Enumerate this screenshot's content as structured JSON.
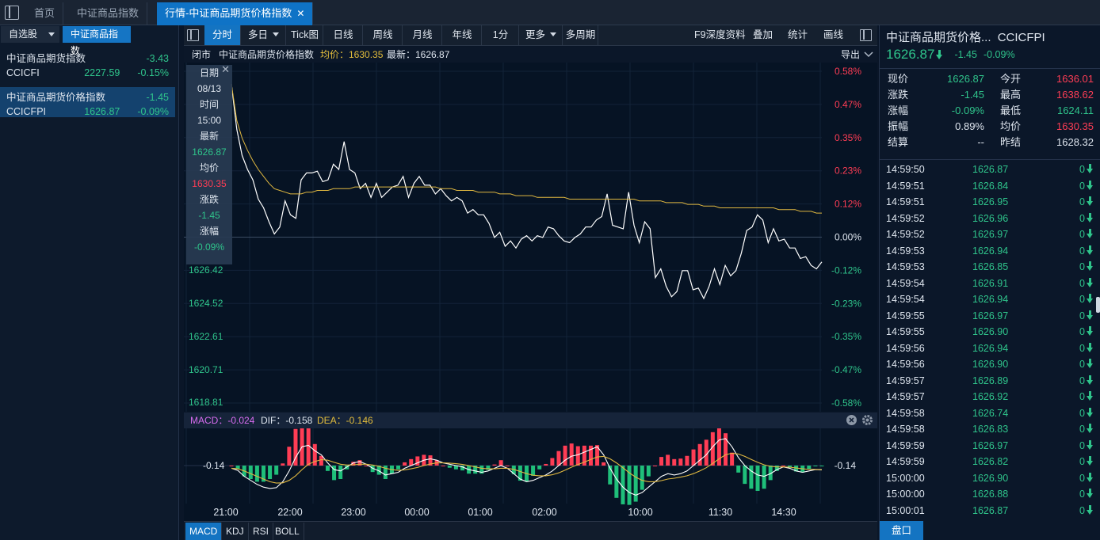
{
  "top_tabs": [
    {
      "label": "首页",
      "active": false
    },
    {
      "label": "中证商品指数",
      "active": false
    },
    {
      "label": "行情-中证商品期货价格指数",
      "active": true
    }
  ],
  "left_panel": {
    "tab1": "自选股",
    "tab2": "中证商品指数",
    "items": [
      {
        "name": "中证商品期货指数",
        "change": "-3.43",
        "code": "CCICFI",
        "price": "2227.59",
        "pct": "-0.15%"
      },
      {
        "name": "中证商品期货价格指数",
        "change": "-1.45",
        "code": "CCICFPI",
        "price": "1626.87",
        "pct": "-0.09%"
      }
    ]
  },
  "toolbar": {
    "items": [
      "分时",
      "多日",
      "Tick图",
      "日线",
      "周线",
      "月线",
      "年线",
      "1分",
      "更多",
      "多周期"
    ],
    "right_items": [
      "F9深度资料",
      "叠加",
      "统计",
      "画线"
    ]
  },
  "info_bar": {
    "status": "闭市",
    "name": "中证商品期货价格指数",
    "avg_label": "均价：1630.35",
    "latest_label": "最新：1626.87",
    "export": "导出"
  },
  "tooltip": {
    "date_label": "日期",
    "date": "08/13",
    "time_label": "时间",
    "time": "15:00",
    "latest_label": "最新",
    "latest": "1626.87",
    "avg_label": "均价",
    "avg": "1630.35",
    "chg_label": "涨跌",
    "chg": "-1.45",
    "pct_label": "涨幅",
    "pct": "-0.09%"
  },
  "macd_bar": {
    "macd": "MACD：-0.024",
    "dif": "DIF：-0.158",
    "dea": "DEA：-0.146"
  },
  "bottom_tabs": [
    "MACD",
    "KDJ",
    "RSI",
    "BOLL"
  ],
  "right_panel": {
    "title": "中证商品期货价格...",
    "code": "CCICFPI",
    "price": "1626.87",
    "change": "-1.45",
    "pct": "-0.09%",
    "quote": [
      {
        "l1": "现价",
        "v1": "1626.87",
        "c1": "green",
        "l2": "今开",
        "v2": "1636.01",
        "c2": "red"
      },
      {
        "l1": "涨跌",
        "v1": "-1.45",
        "c1": "green",
        "l2": "最高",
        "v2": "1638.62",
        "c2": "red"
      },
      {
        "l1": "涨幅",
        "v1": "-0.09%",
        "c1": "green",
        "l2": "最低",
        "v2": "1624.11",
        "c2": "green"
      },
      {
        "l1": "振幅",
        "v1": "0.89%",
        "c1": "white",
        "l2": "均价",
        "v2": "1630.35",
        "c2": "red"
      },
      {
        "l1": "结算",
        "v1": "--",
        "c1": "white",
        "l2": "昨结",
        "v2": "1628.32",
        "c2": "white"
      }
    ],
    "ticks": [
      {
        "time": "14:59:50",
        "price": "1626.87",
        "vol": "0"
      },
      {
        "time": "14:59:51",
        "price": "1626.84",
        "vol": "0"
      },
      {
        "time": "14:59:51",
        "price": "1626.95",
        "vol": "0"
      },
      {
        "time": "14:59:52",
        "price": "1626.96",
        "vol": "0"
      },
      {
        "time": "14:59:52",
        "price": "1626.97",
        "vol": "0"
      },
      {
        "time": "14:59:53",
        "price": "1626.94",
        "vol": "0"
      },
      {
        "time": "14:59:53",
        "price": "1626.85",
        "vol": "0"
      },
      {
        "time": "14:59:54",
        "price": "1626.91",
        "vol": "0"
      },
      {
        "time": "14:59:54",
        "price": "1626.94",
        "vol": "0"
      },
      {
        "time": "14:59:55",
        "price": "1626.97",
        "vol": "0"
      },
      {
        "time": "14:59:55",
        "price": "1626.90",
        "vol": "0"
      },
      {
        "time": "14:59:56",
        "price": "1626.94",
        "vol": "0"
      },
      {
        "time": "14:59:56",
        "price": "1626.90",
        "vol": "0"
      },
      {
        "time": "14:59:57",
        "price": "1626.89",
        "vol": "0"
      },
      {
        "time": "14:59:57",
        "price": "1626.92",
        "vol": "0"
      },
      {
        "time": "14:59:58",
        "price": "1626.74",
        "vol": "0"
      },
      {
        "time": "14:59:58",
        "price": "1626.83",
        "vol": "0"
      },
      {
        "time": "14:59:59",
        "price": "1626.97",
        "vol": "0"
      },
      {
        "time": "14:59:59",
        "price": "1626.82",
        "vol": "0"
      },
      {
        "time": "15:00:00",
        "price": "1626.90",
        "vol": "0"
      },
      {
        "time": "15:00:00",
        "price": "1626.88",
        "vol": "0"
      },
      {
        "time": "15:00:01",
        "price": "1626.87",
        "vol": "0"
      }
    ],
    "pankou": "盘口"
  },
  "chart_data": {
    "type": "line",
    "prev_settle": 1628.32,
    "y_ticks_left": [
      "1626.42",
      "1624.52",
      "1622.61",
      "1620.71",
      "1618.81"
    ],
    "y_ticks_right": [
      "0.58%",
      "0.47%",
      "0.35%",
      "0.23%",
      "0.12%",
      "0.00%",
      "-0.12%",
      "-0.23%",
      "-0.35%",
      "-0.47%",
      "-0.58%"
    ],
    "ylim": [
      1618.81,
      1637.83
    ],
    "x_ticks": [
      "21:00",
      "22:00",
      "23:00",
      "00:00",
      "01:00",
      "02:00",
      "10:00",
      "11:30",
      "14:30"
    ],
    "series": [
      {
        "kind": "price",
        "color": "#ffffff",
        "values": [
          1637.1,
          1634.5,
          1633.0,
          1632.2,
          1631.6,
          1630.5,
          1630.0,
          1629.2,
          1628.5,
          1628.9,
          1630.4,
          1629.6,
          1629.4,
          1631.6,
          1632.0,
          1632.0,
          1632.1,
          1631.5,
          1631.6,
          1632.5,
          1632.2,
          1633.8,
          1632.2,
          1632.0,
          1631.1,
          1631.4,
          1630.6,
          1631.4,
          1630.6,
          1630.9,
          1631.2,
          1631.3,
          1631.8,
          1630.6,
          1631.4,
          1631.8,
          1631.3,
          1631.3,
          1630.8,
          1631.1,
          1630.7,
          1630.4,
          1630.6,
          1630.4,
          1629.7,
          1629.9,
          1629.6,
          1629.6,
          1629.1,
          1628.3,
          1628.6,
          1627.8,
          1628.1,
          1627.7,
          1628.2,
          1628.4,
          1628.1,
          1628.4,
          1628.3,
          1628.9,
          1628.8,
          1628.4,
          1628.1,
          1628.0,
          1628.3,
          1628.5,
          1628.9,
          1628.9,
          1629.3,
          1629.5,
          1630.8,
          1629.0,
          1628.9,
          1628.8,
          1630.9,
          1629.0,
          1628.0,
          1629.2,
          1628.8,
          1626.0,
          1626.5,
          1625.5,
          1624.9,
          1625.2,
          1626.4,
          1626.4,
          1625.3,
          1625.4,
          1624.8,
          1625.5,
          1626.5,
          1625.6,
          1626.7,
          1626.1,
          1626.4,
          1627.4,
          1628.7,
          1628.9,
          1629.6,
          1629.3,
          1628.0,
          1628.8,
          1628.1,
          1628.2,
          1627.7,
          1627.7,
          1627.1,
          1627.2,
          1626.7,
          1626.5,
          1626.9
        ]
      },
      {
        "kind": "average",
        "color": "#e0b840",
        "values": [
          1637.1,
          1635.0,
          1634.0,
          1633.3,
          1632.7,
          1632.2,
          1631.8,
          1631.4,
          1631.1,
          1631.0,
          1630.9,
          1630.8,
          1630.8,
          1630.8,
          1630.9,
          1630.9,
          1631.0,
          1631.0,
          1631.0,
          1631.1,
          1631.1,
          1631.1,
          1631.1,
          1631.2,
          1631.2,
          1631.2,
          1631.2,
          1631.2,
          1631.2,
          1631.2,
          1631.2,
          1631.2,
          1631.2,
          1631.2,
          1631.2,
          1631.2,
          1631.2,
          1631.2,
          1631.2,
          1631.1,
          1631.1,
          1631.1,
          1631.0,
          1631.0,
          1631.0,
          1631.0,
          1630.9,
          1630.9,
          1630.9,
          1630.9,
          1630.8,
          1630.8,
          1630.8,
          1630.7,
          1630.7,
          1630.7,
          1630.7,
          1630.6,
          1630.6,
          1630.6,
          1630.6,
          1630.6,
          1630.6,
          1630.5,
          1630.5,
          1630.5,
          1630.5,
          1630.5,
          1630.5,
          1630.5,
          1630.5,
          1630.5,
          1630.5,
          1630.5,
          1630.5,
          1630.5,
          1630.4,
          1630.4,
          1630.4,
          1630.4,
          1630.4,
          1630.3,
          1630.3,
          1630.3,
          1630.3,
          1630.2,
          1630.2,
          1630.2,
          1630.1,
          1630.1,
          1630.1,
          1630.0,
          1630.0,
          1630.0,
          1630.0,
          1630.0,
          1630.0,
          1630.0,
          1630.0,
          1630.0,
          1630.0,
          1630.0,
          1629.9,
          1629.9,
          1629.9,
          1629.9,
          1629.8,
          1629.8,
          1629.8,
          1629.7,
          1629.7
        ]
      }
    ]
  },
  "macd_data": {
    "y_label": "-0.14",
    "dif": [
      -0.1,
      -0.18,
      -0.4,
      -0.55,
      -0.7,
      -0.8,
      -0.85,
      -0.82,
      -0.6,
      -0.2,
      0.3,
      0.7,
      0.75,
      0.55,
      0.4,
      0.1,
      -0.15,
      -0.2,
      -0.05,
      0.1,
      0.15,
      0.05,
      -0.1,
      -0.2,
      -0.35,
      -0.3,
      -0.25,
      -0.1,
      0.0,
      0.1,
      0.2,
      0.25,
      0.2,
      0.1,
      0.05,
      0.0,
      -0.05,
      -0.15,
      -0.2,
      -0.25,
      -0.2,
      -0.1,
      0.0,
      -0.1,
      -0.3,
      -0.5,
      -0.6,
      -0.55,
      -0.45,
      -0.35,
      -0.2,
      0.0,
      0.2,
      0.35,
      0.4,
      0.5,
      0.6,
      0.7,
      0.4,
      -0.1,
      -0.5,
      -0.8,
      -1.0,
      -1.1,
      -1.0,
      -0.8,
      -0.6,
      -0.4,
      -0.3,
      -0.35,
      -0.3,
      -0.2,
      0.0,
      0.2,
      0.4,
      0.7,
      0.95,
      1.0,
      0.7,
      0.3,
      0.0,
      -0.2,
      -0.35,
      -0.4,
      -0.3,
      -0.15,
      -0.05,
      -0.1,
      -0.2,
      -0.25,
      -0.2,
      -0.15,
      -0.16
    ],
    "dea": [
      -0.1,
      -0.12,
      -0.2,
      -0.3,
      -0.4,
      -0.5,
      -0.6,
      -0.65,
      -0.64,
      -0.55,
      -0.38,
      -0.15,
      0.05,
      0.15,
      0.22,
      0.2,
      0.12,
      0.05,
      0.02,
      0.03,
      0.05,
      0.05,
      0.02,
      -0.03,
      -0.1,
      -0.15,
      -0.18,
      -0.16,
      -0.12,
      -0.07,
      0.0,
      0.06,
      0.1,
      0.1,
      0.09,
      0.07,
      0.04,
      0.0,
      -0.05,
      -0.1,
      -0.12,
      -0.12,
      -0.1,
      -0.1,
      -0.14,
      -0.22,
      -0.3,
      -0.36,
      -0.38,
      -0.38,
      -0.34,
      -0.27,
      -0.17,
      -0.06,
      0.04,
      0.13,
      0.23,
      0.32,
      0.34,
      0.25,
      0.1,
      -0.08,
      -0.27,
      -0.43,
      -0.55,
      -0.6,
      -0.6,
      -0.56,
      -0.5,
      -0.47,
      -0.43,
      -0.38,
      -0.3,
      -0.2,
      -0.08,
      0.08,
      0.25,
      0.4,
      0.46,
      0.43,
      0.34,
      0.23,
      0.12,
      0.03,
      -0.03,
      -0.05,
      -0.05,
      -0.06,
      -0.09,
      -0.12,
      -0.14,
      -0.14,
      -0.15
    ]
  }
}
